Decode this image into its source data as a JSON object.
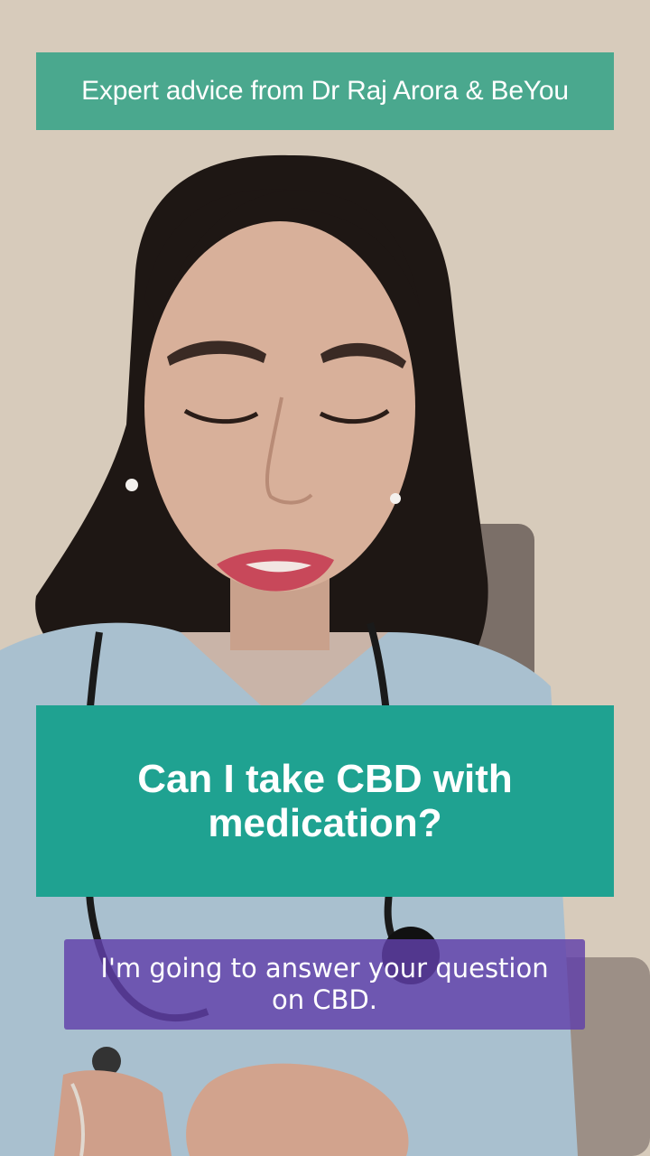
{
  "video": {
    "scene": "doctor-speaking"
  },
  "top_banner": {
    "text": "Expert advice from Dr Raj Arora & BeYou",
    "color": "#4aa88e"
  },
  "question_card": {
    "text": "Can I take CBD with medication?",
    "color": "#1fa291"
  },
  "caption": {
    "text": "I'm going to answer your question on CBD.",
    "color": "#6040aa"
  }
}
